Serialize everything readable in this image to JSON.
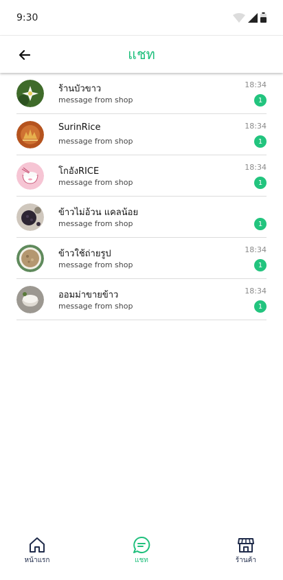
{
  "status_bar": {
    "time": "9:30"
  },
  "header": {
    "title": "แชท"
  },
  "chats": [
    {
      "name": "ร้านบัวขาว",
      "preview": "message from shop",
      "time": "18:34",
      "unread": "1"
    },
    {
      "name": "SurinRice",
      "preview": "message from shop",
      "time": "18:34",
      "unread": "1"
    },
    {
      "name": "โกอังRICE",
      "preview": "message from shop",
      "time": "18:34",
      "unread": "1"
    },
    {
      "name": "ข้าวไม่อ้วน แคลน้อย",
      "preview": "message from shop",
      "time": "",
      "unread": "1"
    },
    {
      "name": "ข้าวใช้ถ่ายรูป",
      "preview": "message from shop",
      "time": "18:34",
      "unread": "1"
    },
    {
      "name": "ออมม่าขายข้าว",
      "preview": "message from shop",
      "time": "18:34",
      "unread": "1"
    }
  ],
  "bottom_nav": {
    "home_label": "หน้าแรก",
    "chat_label": "แชท",
    "shop_label": "ร้านค้า"
  },
  "colors": {
    "accent": "#1fbf7c",
    "badge": "#22c47e",
    "nav_icon": "#1f2b4a"
  }
}
